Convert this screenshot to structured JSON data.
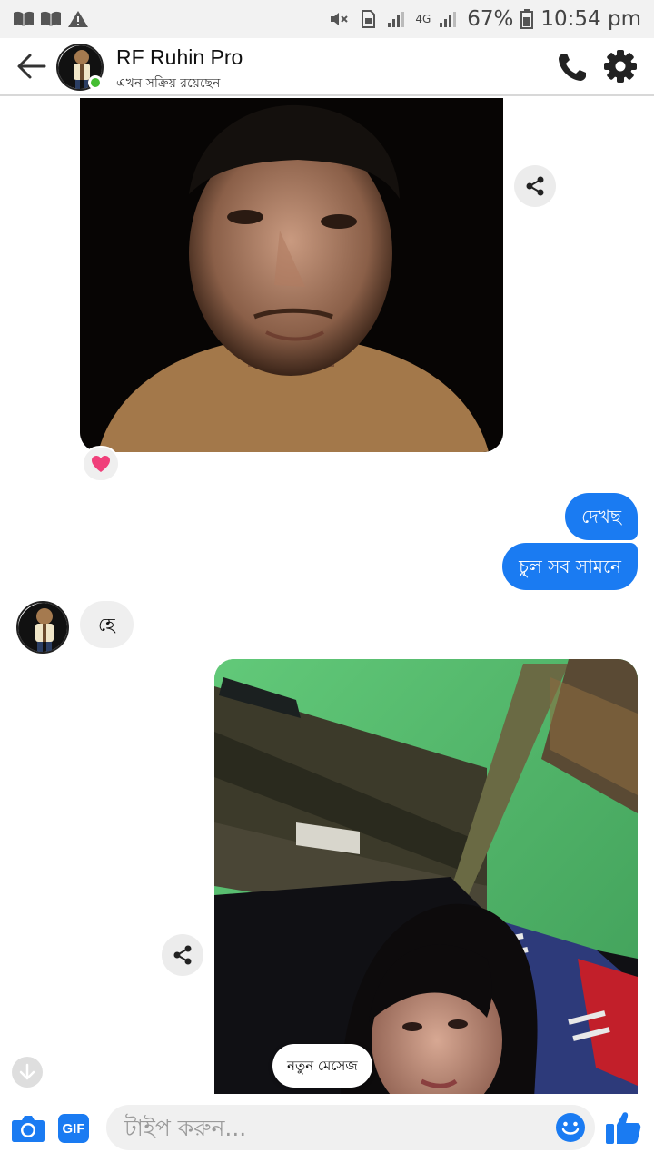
{
  "status_bar": {
    "battery_percent": "67%",
    "time": "10:54 pm",
    "network_label": "4G",
    "left_icons": [
      "book-icon",
      "book-icon",
      "warning-icon"
    ],
    "right_icons": [
      "mute-icon",
      "sim-icon",
      "signal-icon",
      "signal-icon",
      "battery-icon"
    ]
  },
  "header": {
    "contact_name": "RF Ruhin Pro",
    "contact_status": "এখন সক্রিয় রয়েছেন",
    "online": true,
    "icons": [
      "back-arrow-icon",
      "phone-icon",
      "gear-icon"
    ],
    "accent_color": "#1a7bf2"
  },
  "thread": {
    "messages": [
      {
        "type": "photo",
        "direction": "incoming",
        "reaction": "heart"
      },
      {
        "type": "text",
        "direction": "outgoing",
        "text": "দেখছ"
      },
      {
        "type": "text",
        "direction": "outgoing",
        "text": "চুল সব সামনে"
      },
      {
        "type": "text",
        "direction": "incoming",
        "text": "হে"
      },
      {
        "type": "photo",
        "direction": "outgoing"
      }
    ],
    "new_message_pill": "নতুন মেসেজ"
  },
  "composer": {
    "placeholder": "টাইপ করুন...",
    "gif_label": "GIF",
    "icons": [
      "camera-icon",
      "emoji-icon",
      "thumbs-up-icon"
    ]
  }
}
